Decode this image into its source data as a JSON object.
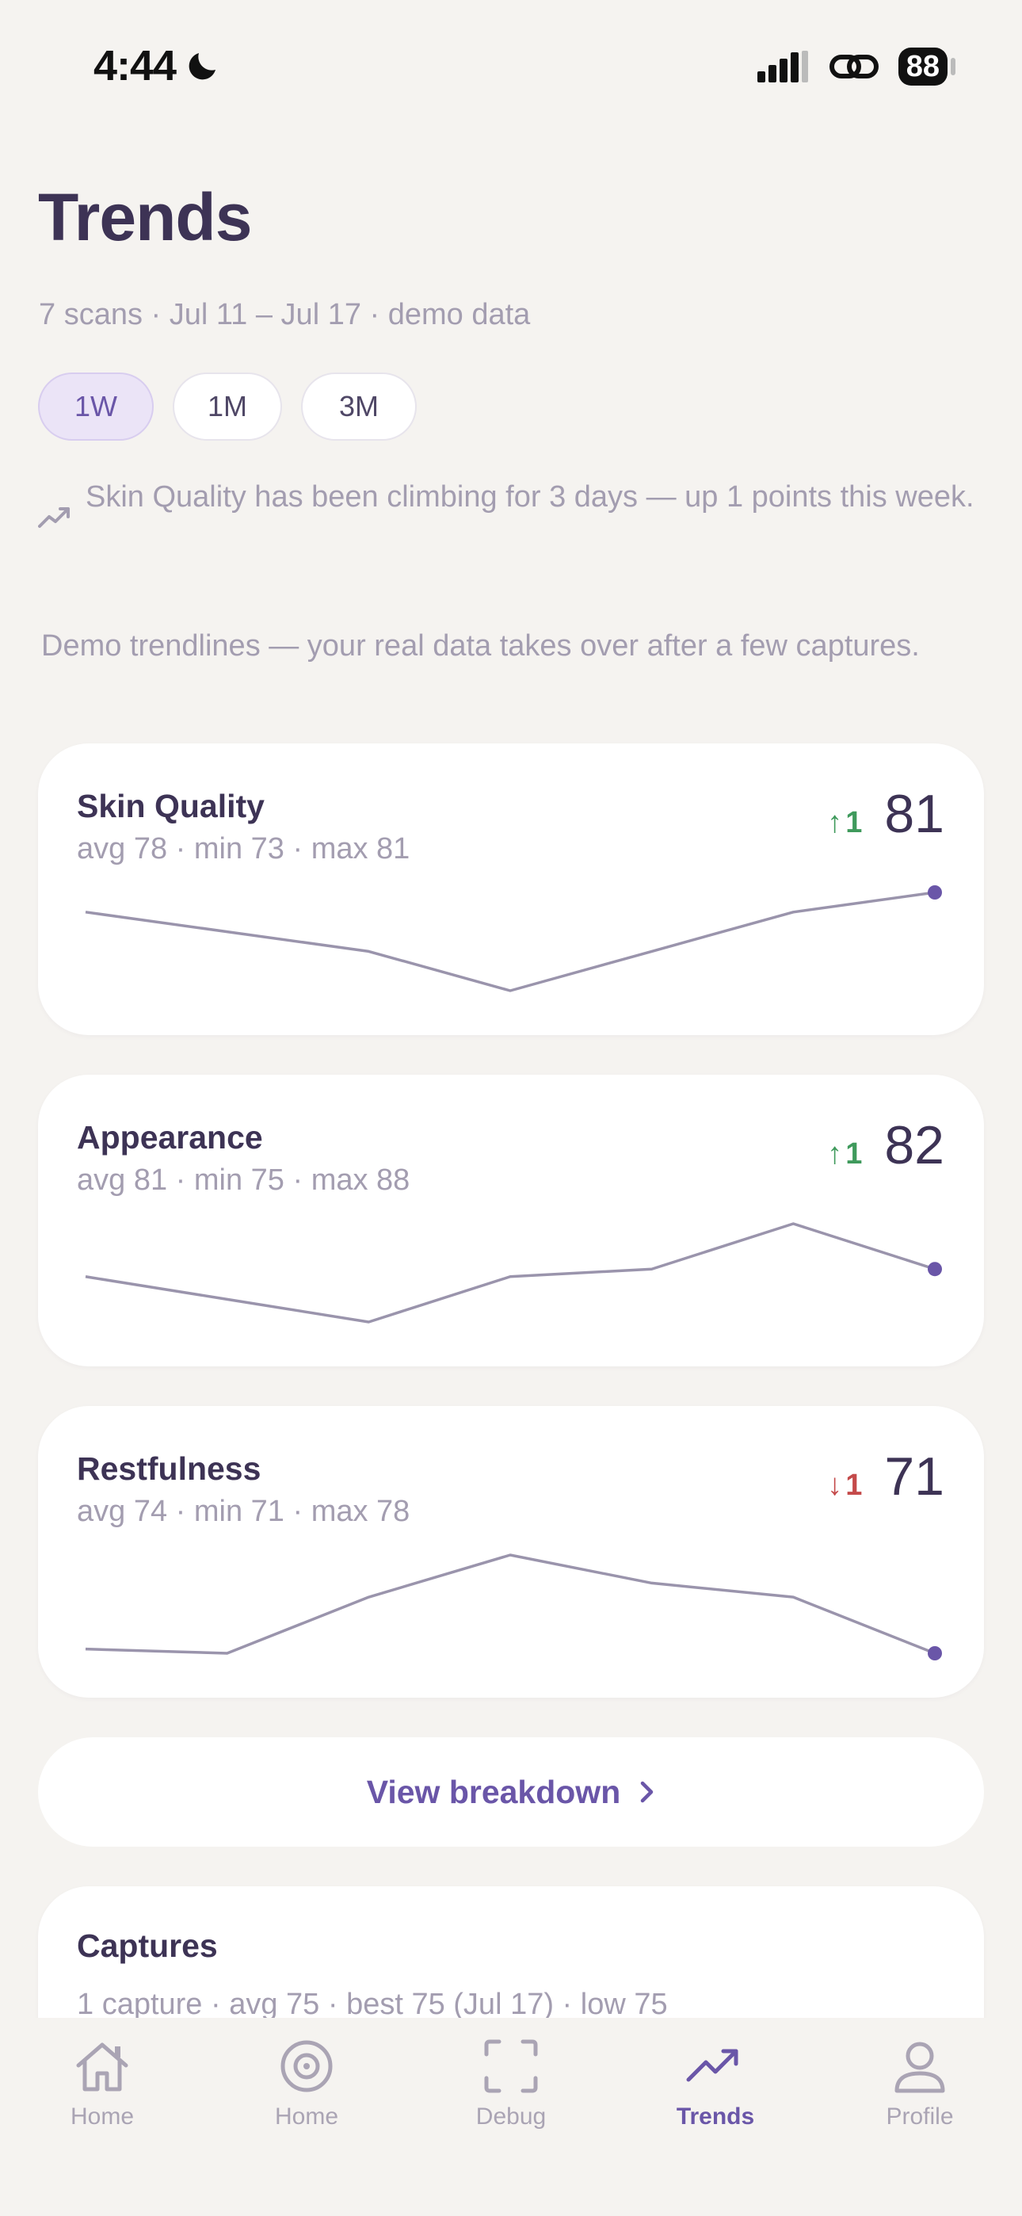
{
  "status_bar": {
    "time": "4:44",
    "battery": "88"
  },
  "header": {
    "title": "Trends",
    "subtitle": "7 scans · Jul 11 – Jul 17 · demo data"
  },
  "ranges": [
    {
      "label": "1W",
      "active": true
    },
    {
      "label": "1M",
      "active": false
    },
    {
      "label": "3M",
      "active": false
    }
  ],
  "insight": "Skin Quality has been climbing for 3 days — up 1 points this week.",
  "demo_note": "Demo trendlines — your real data takes over after a few captures.",
  "metrics": [
    {
      "name": "Skin Quality",
      "stats": "avg 78 · min 73 · max 81",
      "delta": "1",
      "direction": "up",
      "value": "81",
      "trend": [
        80,
        79,
        78,
        76,
        78,
        80,
        81
      ]
    },
    {
      "name": "Appearance",
      "stats": "avg 81 · min 75 · max 88",
      "delta": "1",
      "direction": "up",
      "value": "82",
      "trend": [
        81,
        78,
        75,
        81,
        82,
        88,
        82
      ]
    },
    {
      "name": "Restfulness",
      "stats": "avg 74 · min 71 · max 78",
      "delta": "1",
      "direction": "down",
      "value": "71",
      "trend": [
        71.3,
        71,
        75,
        78,
        76,
        75,
        71
      ]
    }
  ],
  "breakdown": {
    "label": "View breakdown"
  },
  "captures": {
    "title": "Captures",
    "stats": "1 capture · avg 75 · best 75 (Jul 17) · low 75"
  },
  "tabs": [
    {
      "label": "Home",
      "icon": "house-icon",
      "active": false
    },
    {
      "label": "Home",
      "icon": "target-icon",
      "active": false
    },
    {
      "label": "Debug",
      "icon": "scan-frame-icon",
      "active": false
    },
    {
      "label": "Trends",
      "icon": "trend-icon",
      "active": true
    },
    {
      "label": "Profile",
      "icon": "person-icon",
      "active": false
    }
  ],
  "colors": {
    "accent": "#6a56a8",
    "trend_line": "#9a94ac",
    "up": "#3f9a5c",
    "down": "#c44a4a"
  }
}
